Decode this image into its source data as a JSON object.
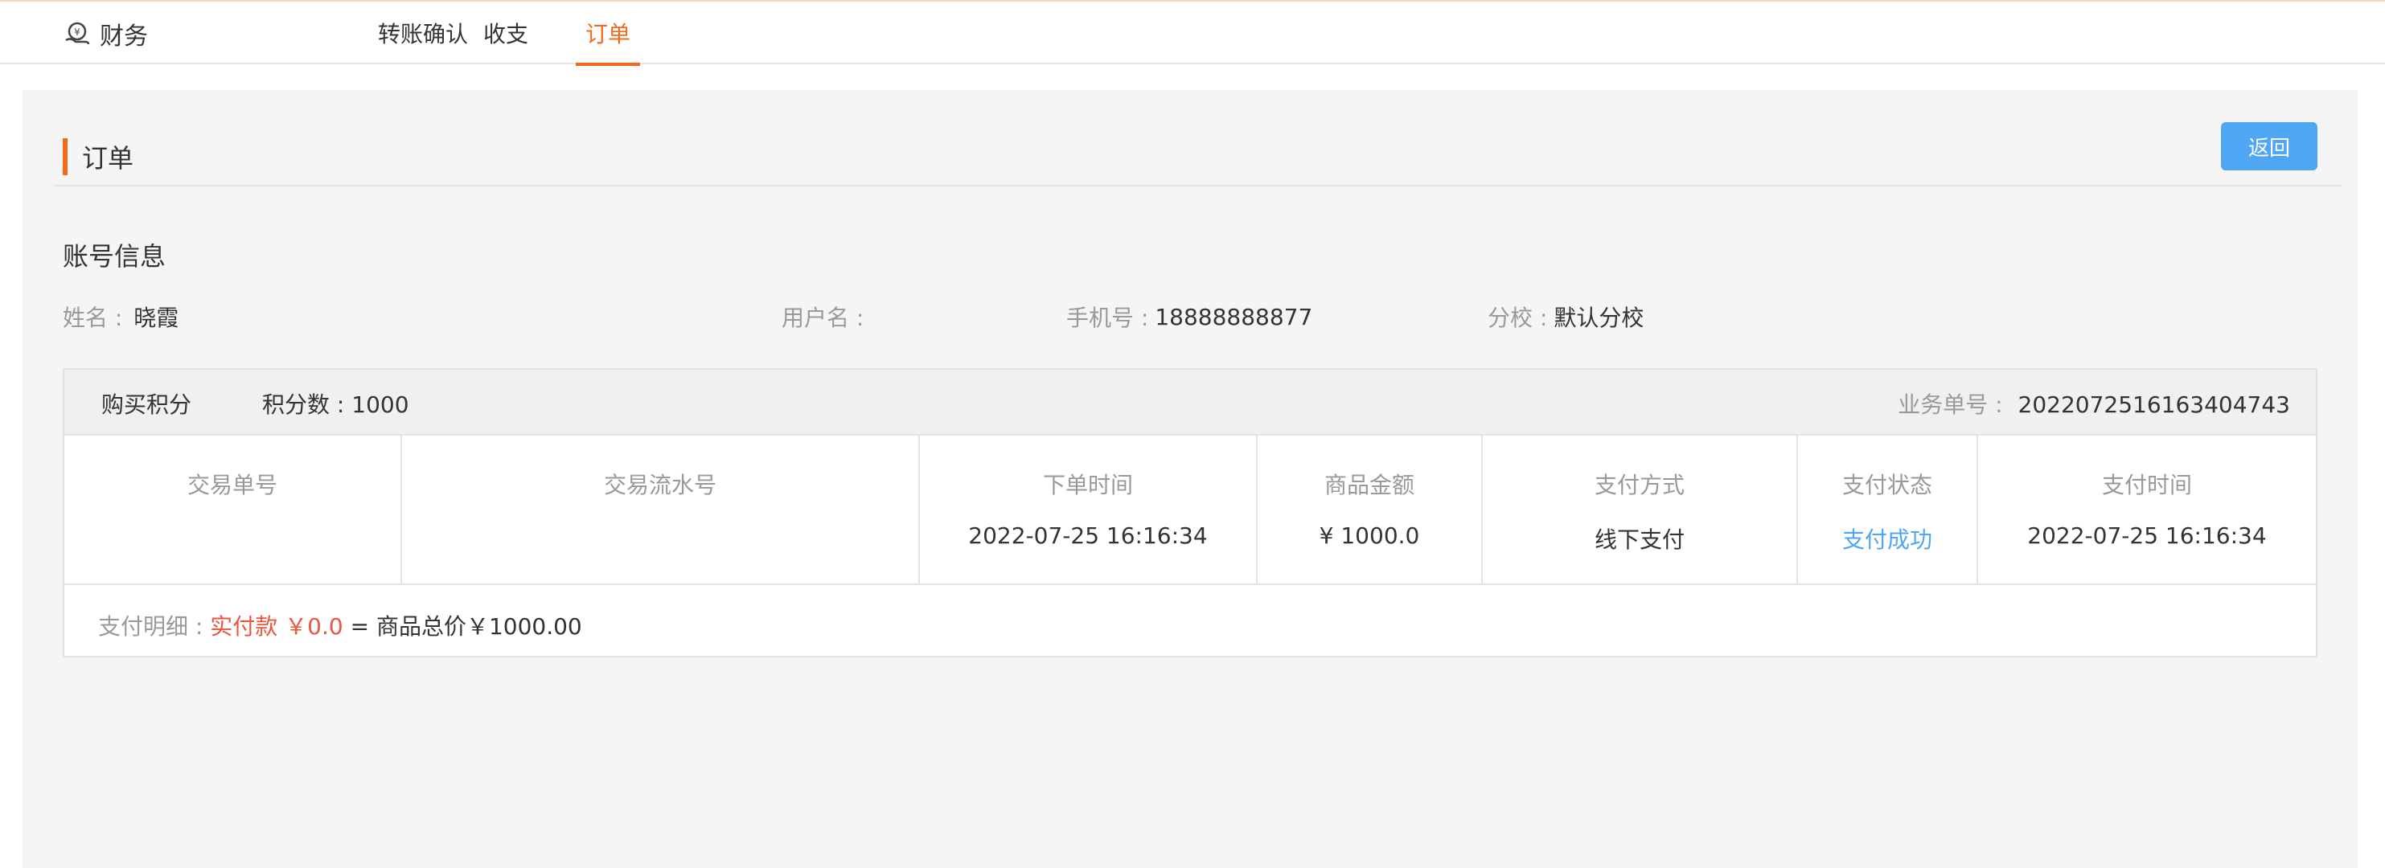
{
  "header": {
    "app_title": "财务",
    "tabs": [
      {
        "label": "转账确认",
        "active": false
      },
      {
        "label": "收支",
        "active": false
      },
      {
        "label": "订单",
        "active": true
      }
    ],
    "accent_color": "#f26b1d"
  },
  "page": {
    "section_title": "订单",
    "back_button": "返回",
    "account_section_title": "账号信息",
    "account": {
      "name_label": "姓名 :",
      "name_value": "晓霞",
      "username_label": "用户名 :",
      "username_value": "",
      "phone_label": "手机号 :",
      "phone_value": "18888888877",
      "branch_label": "分校 :",
      "branch_value": "默认分校"
    }
  },
  "order": {
    "type": "购买积分",
    "points_label": "积分数 :",
    "points_value": "1000",
    "biz_no_label": "业务单号 :",
    "biz_no_value": "2022072516163404743",
    "columns": [
      {
        "header": "交易单号",
        "value": ""
      },
      {
        "header": "交易流水号",
        "value": ""
      },
      {
        "header": "下单时间",
        "value": "2022-07-25 16:16:34"
      },
      {
        "header": "商品金额",
        "value": "¥ 1000.0"
      },
      {
        "header": "支付方式",
        "value": "线下支付"
      },
      {
        "header": "支付状态",
        "value": "支付成功"
      },
      {
        "header": "支付时间",
        "value": "2022-07-25 16:16:34"
      }
    ],
    "detail_label": "支付明细 :",
    "detail_paid": "实付款 ￥0.0",
    "detail_rest": "= 商品总价￥1000.00",
    "status_color": "#4fa6f3",
    "paid_color": "#e9573f"
  }
}
